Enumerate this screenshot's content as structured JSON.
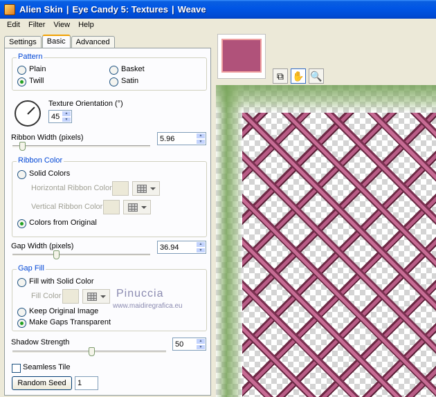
{
  "window": {
    "title_app": "Alien Skin",
    "title_product": "Eye Candy 5: Textures",
    "title_filter": "Weave",
    "sep": "|"
  },
  "menu": [
    "Edit",
    "Filter",
    "View",
    "Help"
  ],
  "tabs": [
    "Settings",
    "Basic",
    "Advanced"
  ],
  "active_tab": "Basic",
  "pattern": {
    "title": "Pattern",
    "options": [
      "Plain",
      "Basket",
      "Twill",
      "Satin"
    ],
    "selected": "Twill"
  },
  "texture_orientation": {
    "label": "Texture Orientation (°)",
    "value": "45"
  },
  "ribbon_width": {
    "label": "Ribbon Width (pixels)",
    "value": "5.96",
    "slider_fraction": 0.07
  },
  "ribbon_color": {
    "title": "Ribbon Color",
    "solid_colors_label": "Solid Colors",
    "horizontal_label": "Horizontal Ribbon Color",
    "vertical_label": "Vertical Ribbon Color",
    "colors_from_original_label": "Colors from Original",
    "selected": "Colors from Original"
  },
  "gap_width": {
    "label": "Gap Width (pixels)",
    "value": "36.94",
    "slider_fraction": 0.3
  },
  "gap_fill": {
    "title": "Gap Fill",
    "fill_solid_label": "Fill with Solid Color",
    "fill_color_label": "Fill Color",
    "keep_original_label": "Keep Original Image",
    "make_transparent_label": "Make Gaps Transparent",
    "selected": "Make Gaps Transparent"
  },
  "shadow_strength": {
    "label": "Shadow Strength",
    "value": "50",
    "slider_fraction": 0.5
  },
  "seamless_tile": {
    "label": "Seamless Tile",
    "checked": false
  },
  "random_seed": {
    "button_label": "Random Seed",
    "value": "1"
  },
  "watermark": {
    "line1": "Pinuccia",
    "line2": "www.maidiregrafica.eu"
  },
  "colors": {
    "thumbnail": "#b0527a",
    "ribbon": "#c76b94",
    "ribbon_dark": "#6b2a45",
    "accent": "#0046d5"
  },
  "preview_tools": [
    "navigator-icon",
    "hand-icon",
    "zoom-icon"
  ]
}
